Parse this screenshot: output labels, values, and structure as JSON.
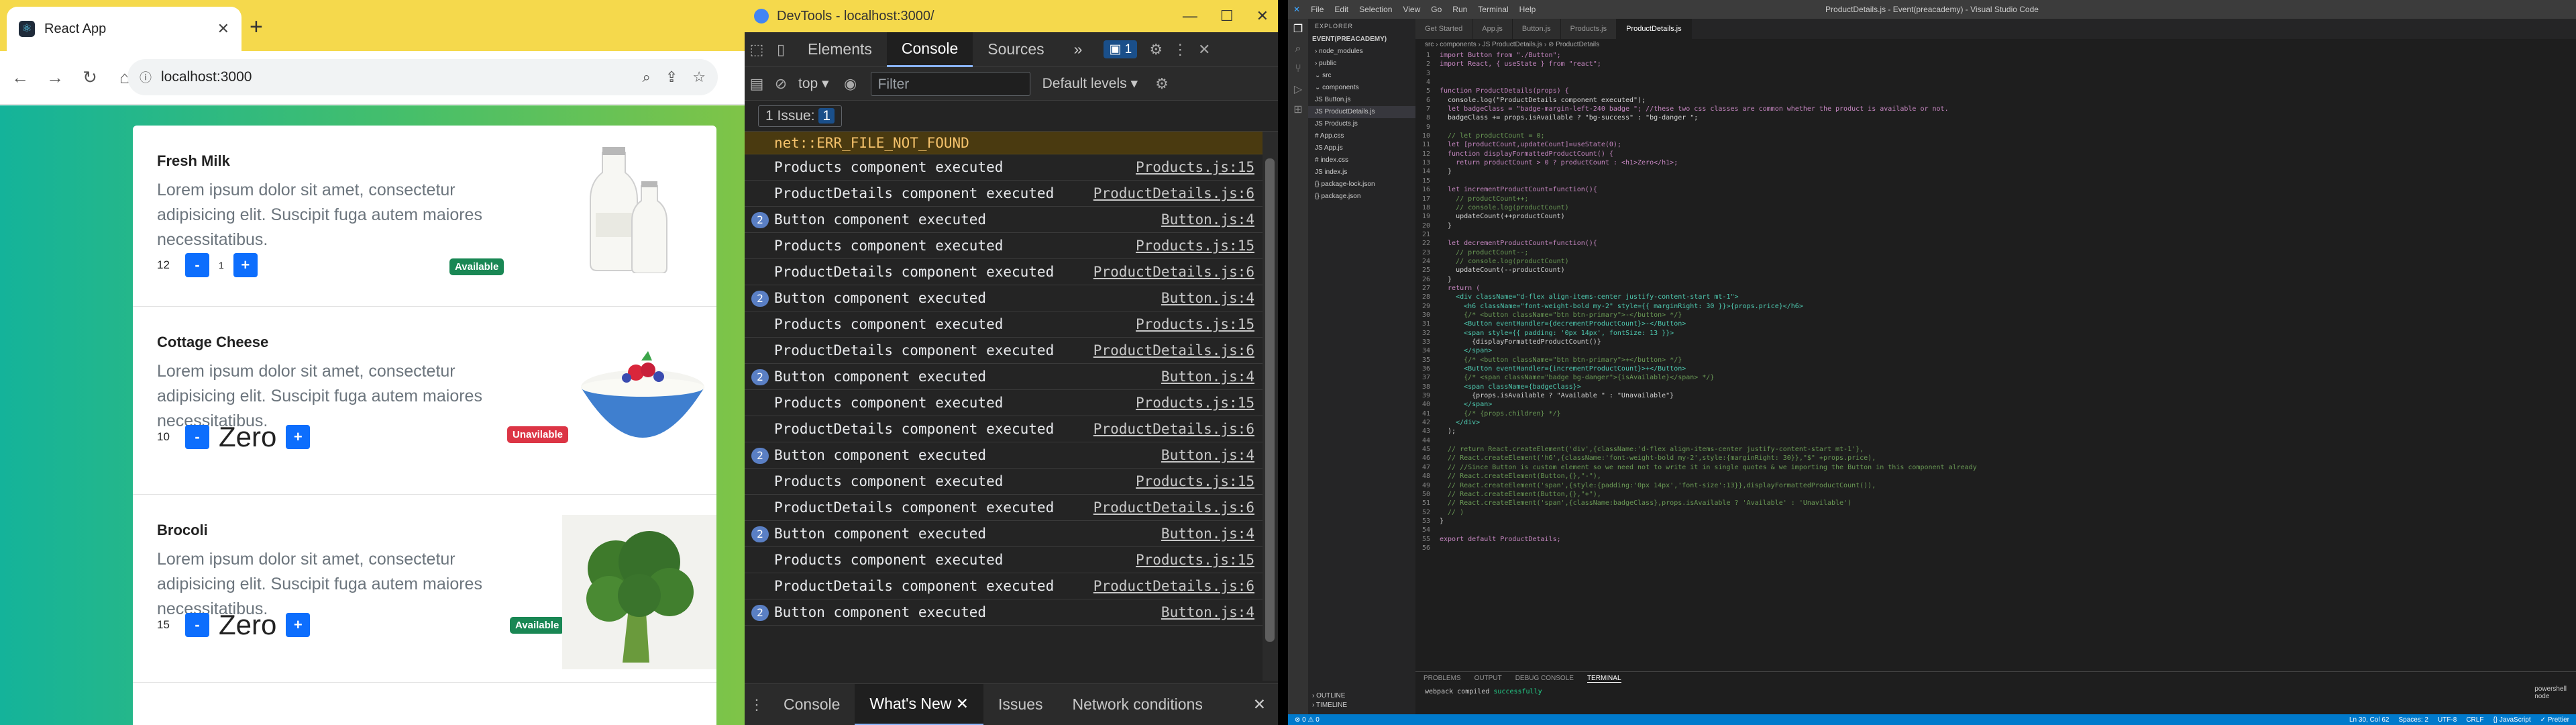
{
  "chrome": {
    "tab_title": "React App",
    "tab_close": "✕",
    "new_tab": "+",
    "url": "localhost:3000",
    "products": [
      {
        "name": "Fresh Milk",
        "desc": "Lorem ipsum dolor sit amet, consectetur adipisicing elit. Suscipit fuga autem maiores necessitatibus.",
        "price": "12",
        "count": "1",
        "minus": "-",
        "plus": "+",
        "badge": "Available",
        "available": true
      },
      {
        "name": "Cottage Cheese",
        "desc": "Lorem ipsum dolor sit amet, consectetur adipisicing elit. Suscipit fuga autem maiores necessitatibus.",
        "price": "10",
        "count": "Zero",
        "minus": "-",
        "plus": "+",
        "badge": "Unavilable",
        "available": false
      },
      {
        "name": "Brocoli",
        "desc": "Lorem ipsum dolor sit amet, consectetur adipisicing elit. Suscipit fuga autem maiores necessitatibus.",
        "price": "15",
        "count": "Zero",
        "minus": "-",
        "plus": "+",
        "badge": "Available",
        "available": true
      }
    ]
  },
  "devtools": {
    "title": "DevTools - localhost:3000/",
    "tabs": [
      "Elements",
      "Console",
      "Sources"
    ],
    "more": "»",
    "issues_count": "1",
    "context": "top",
    "filter_placeholder": "Filter",
    "levels": "Default levels",
    "issues_label": "1 Issue:",
    "issues_badge": "1",
    "error": "net::ERR_FILE_NOT_FOUND",
    "log": [
      {
        "msg": "Products component executed",
        "src": "Products.js:15",
        "rep": ""
      },
      {
        "msg": "ProductDetails component executed",
        "src": "ProductDetails.js:6",
        "rep": ""
      },
      {
        "msg": "Button component executed",
        "src": "Button.js:4",
        "rep": "2"
      },
      {
        "msg": "Products component executed",
        "src": "Products.js:15",
        "rep": ""
      },
      {
        "msg": "ProductDetails component executed",
        "src": "ProductDetails.js:6",
        "rep": ""
      },
      {
        "msg": "Button component executed",
        "src": "Button.js:4",
        "rep": "2"
      },
      {
        "msg": "Products component executed",
        "src": "Products.js:15",
        "rep": ""
      },
      {
        "msg": "ProductDetails component executed",
        "src": "ProductDetails.js:6",
        "rep": ""
      },
      {
        "msg": "Button component executed",
        "src": "Button.js:4",
        "rep": "2"
      },
      {
        "msg": "Products component executed",
        "src": "Products.js:15",
        "rep": ""
      },
      {
        "msg": "ProductDetails component executed",
        "src": "ProductDetails.js:6",
        "rep": ""
      },
      {
        "msg": "Button component executed",
        "src": "Button.js:4",
        "rep": "2"
      },
      {
        "msg": "Products component executed",
        "src": "Products.js:15",
        "rep": ""
      },
      {
        "msg": "ProductDetails component executed",
        "src": "ProductDetails.js:6",
        "rep": ""
      },
      {
        "msg": "Button component executed",
        "src": "Button.js:4",
        "rep": "2"
      },
      {
        "msg": "Products component executed",
        "src": "Products.js:15",
        "rep": ""
      },
      {
        "msg": "ProductDetails component executed",
        "src": "ProductDetails.js:6",
        "rep": ""
      },
      {
        "msg": "Button component executed",
        "src": "Button.js:4",
        "rep": "2"
      }
    ],
    "drawer_tabs": [
      "Console",
      "What's New",
      "Issues",
      "Network conditions"
    ],
    "drawer_close": "✕",
    "whatsnew_close": "✕"
  },
  "vscode": {
    "title": "ProductDetails.js - Event(preacademy) - Visual Studio Code",
    "menu": [
      "File",
      "Edit",
      "Selection",
      "View",
      "Go",
      "Run",
      "Terminal",
      "Help"
    ],
    "explorer_title": "EXPLORER",
    "project": "EVENT(PREACADEMY)",
    "tree": [
      "› node_modules",
      "› public",
      "⌄ src",
      "  ⌄ components",
      "    JS Button.js",
      "    JS ProductDetails.js",
      "    JS Products.js",
      "  # App.css",
      "  JS App.js",
      "  # index.css",
      "  JS index.js",
      "{} package-lock.json",
      "{} package.json"
    ],
    "outline": "› OUTLINE",
    "timeline": "› TIMELINE",
    "tabs": [
      "Get Started",
      "App.js",
      "Button.js",
      "Products.js",
      "ProductDetails.js"
    ],
    "breadcrumb": "src › components › JS ProductDetails.js › ⊘ ProductDetails",
    "code": [
      "import Button from \"./Button\";",
      "import React, { useState } from \"react\";",
      "",
      "",
      "function ProductDetails(props) {",
      "  console.log(\"ProductDetails component executed\");",
      "  let badgeClass = \"badge-margin-left-240 badge \"; //these two css classes are common whether the product is available or not.",
      "  badgeClass += props.isAvailable ? \"bg-success\" : \"bg-danger \";",
      "",
      "  // let productCount = 0;",
      "  let [productCount,updateCount]=useState(0);",
      "  function displayFormattedProductCount() {",
      "    return productCount > 0 ? productCount : <h1>Zero</h1>;",
      "  }",
      "",
      "  let incrementProductCount=function(){",
      "    // productCount++;",
      "    // console.log(productCount)",
      "    updateCount(++productCount)",
      "  }",
      "",
      "  let decrementProductCount=function(){",
      "    // productCount--;",
      "    // console.log(productCount)",
      "    updateCount(--productCount)",
      "  }",
      "  return (",
      "    <div className=\"d-flex align-items-center justify-content-start mt-1\">",
      "      <h6 className=\"font-weight-bold my-2\" style={{ marginRight: 30 }}>{props.price}</h6>",
      "      {/* <button className=\"btn btn-primary\">-</button> */}",
      "      <Button eventHandler={decrementProductCount}>-</Button>",
      "      <span style={{ padding: '0px 14px', fontSize: 13 }}>",
      "        {displayFormattedProductCount()}",
      "      </span>",
      "      {/* <button className=\"btn btn-primary\">+</button> */}",
      "      <Button eventHandler={incrementProductCount}>+</Button>",
      "      {/* <span className=\"badge bg-danger\">{isAvailable}</span> */}",
      "      <span className={badgeClass}>",
      "        {props.isAvailable ? \"Available \" : \"Unavailable\"}",
      "      </span>",
      "      {/* {props.children} */}",
      "    </div>",
      "  );",
      "",
      "  // return React.createElement('div',{className:'d-flex align-items-center justify-content-start mt-1'},",
      "  // React.createElement('h6',{className:'font-weight-bold my-2',style:{marginRight: 30}},\"$\" +props.price),",
      "  // //Since Button is custom element so we need not to write it in single quotes & we importing the Button in this component already",
      "  // React.createElement(Button,{},\"-\"),",
      "  // React.createElement('span',{style:{padding:'0px 14px','font-size':13}},displayFormattedProductCount()),",
      "  // React.createElement(Button,{},\"+\"),",
      "  // React.createElement('span',{className:badgeClass},props.isAvailable ? 'Available' : 'Unavilable')",
      "  // )",
      "}",
      "",
      "export default ProductDetails;",
      ""
    ],
    "panel_tabs": [
      "PROBLEMS",
      "OUTPUT",
      "DEBUG CONSOLE",
      "TERMINAL"
    ],
    "terminal_prefix": "webpack compiled ",
    "terminal_ok": "successfully",
    "terminal_list": [
      "powershell",
      "node"
    ],
    "status_left": "⊗ 0 ⚠ 0",
    "status_right": [
      "Ln 30, Col 62",
      "Spaces: 2",
      "UTF-8",
      "CRLF",
      "{} JavaScript",
      "✓ Prettier"
    ]
  }
}
